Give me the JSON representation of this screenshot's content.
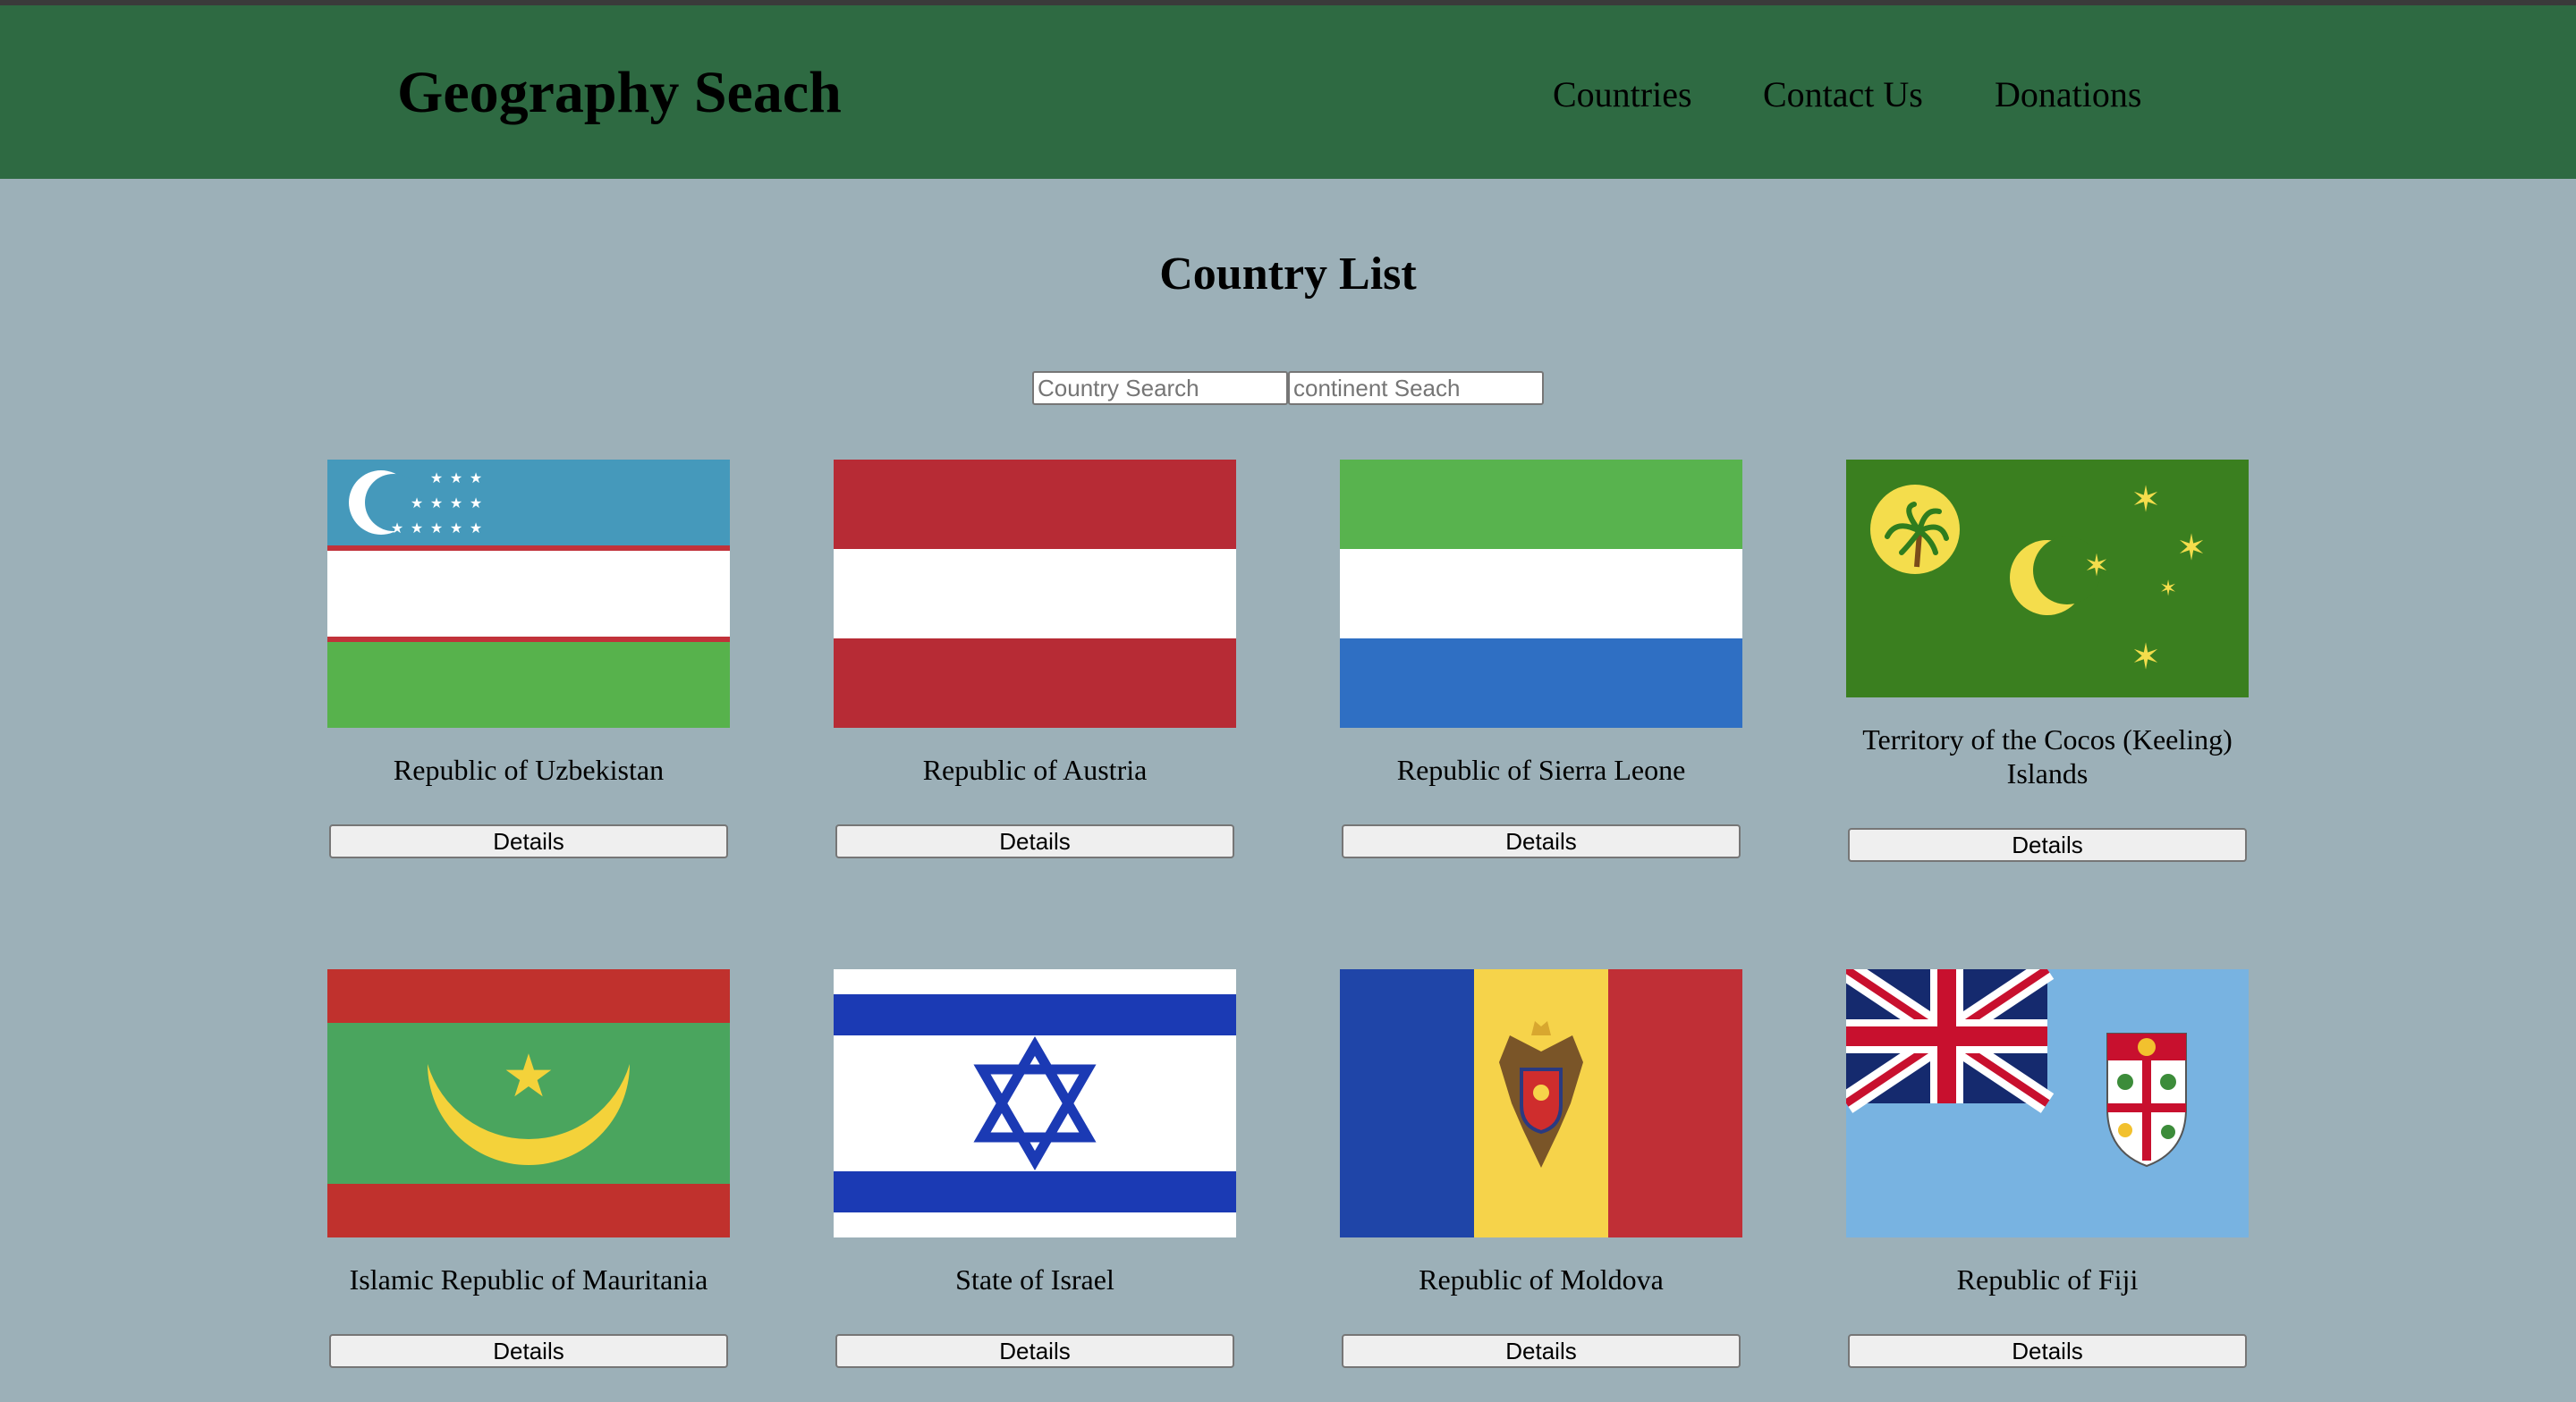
{
  "header": {
    "title": "Geography Seach",
    "nav": [
      "Countries",
      "Contact Us",
      "Donations"
    ]
  },
  "main": {
    "title": "Country List",
    "country_search_placeholder": "Country Search",
    "continent_search_placeholder": "continent Seach",
    "details_label": "Details",
    "countries": [
      {
        "name": "Republic of Uzbekistan",
        "flag": "uzbekistan-flag-icon"
      },
      {
        "name": "Republic of Austria",
        "flag": "austria-flag-icon"
      },
      {
        "name": "Republic of Sierra Leone",
        "flag": "sierra-leone-flag-icon"
      },
      {
        "name": "Territory of the Cocos (Keeling) Islands",
        "flag": "cocos-keeling-islands-flag-icon"
      },
      {
        "name": "Islamic Republic of Mauritania",
        "flag": "mauritania-flag-icon"
      },
      {
        "name": "State of Israel",
        "flag": "israel-flag-icon"
      },
      {
        "name": "Republic of Moldova",
        "flag": "moldova-flag-icon"
      },
      {
        "name": "Republic of Fiji",
        "flag": "fiji-flag-icon"
      }
    ]
  },
  "colors": {
    "header_bg": "#2e6a42",
    "page_bg": "#9cb0b8"
  }
}
